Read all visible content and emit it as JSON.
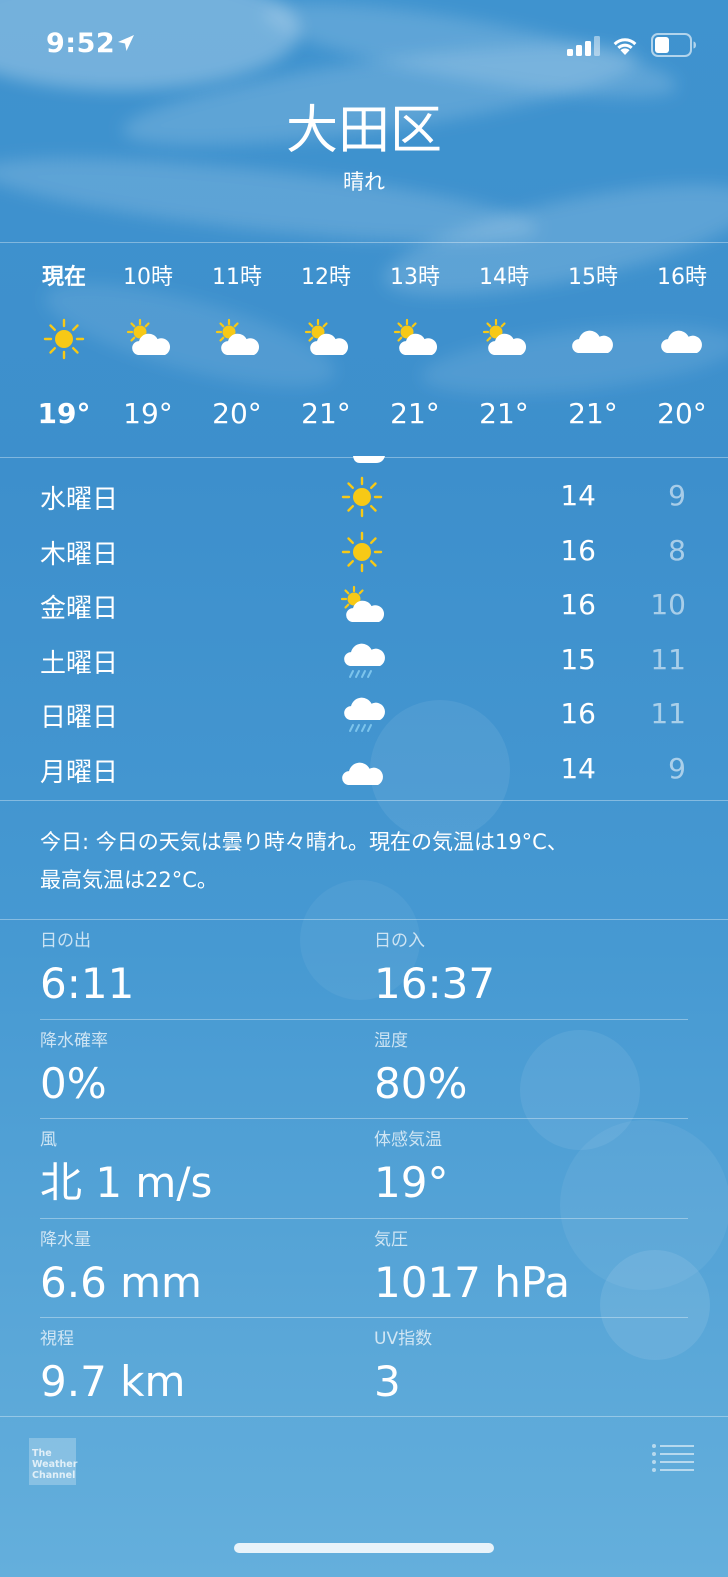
{
  "status_bar": {
    "time": "9:52"
  },
  "header": {
    "city": "大田区",
    "condition": "晴れ"
  },
  "hourly": [
    {
      "label": "現在",
      "icon": "sun-icon",
      "temp": "19°"
    },
    {
      "label": "10時",
      "icon": "partly-cloudy-icon",
      "temp": "19°"
    },
    {
      "label": "11時",
      "icon": "partly-cloudy-icon",
      "temp": "20°"
    },
    {
      "label": "12時",
      "icon": "partly-cloudy-icon",
      "temp": "21°"
    },
    {
      "label": "13時",
      "icon": "partly-cloudy-icon",
      "temp": "21°"
    },
    {
      "label": "14時",
      "icon": "partly-cloudy-icon",
      "temp": "21°"
    },
    {
      "label": "15時",
      "icon": "cloud-icon",
      "temp": "21°"
    },
    {
      "label": "16時",
      "icon": "cloud-icon",
      "temp": "20°"
    }
  ],
  "daily": [
    {
      "day": "水曜日",
      "icon": "sun-icon",
      "high": "14",
      "low": "9"
    },
    {
      "day": "木曜日",
      "icon": "sun-icon",
      "high": "16",
      "low": "8"
    },
    {
      "day": "金曜日",
      "icon": "partly-cloudy-icon",
      "high": "16",
      "low": "10"
    },
    {
      "day": "土曜日",
      "icon": "rain-icon",
      "high": "15",
      "low": "11"
    },
    {
      "day": "日曜日",
      "icon": "rain-icon",
      "high": "16",
      "low": "11"
    },
    {
      "day": "月曜日",
      "icon": "cloud-icon",
      "high": "14",
      "low": "9"
    }
  ],
  "summary": {
    "line1": "今日: 今日の天気は曇り時々晴れ。現在の気温は19°C、",
    "line2": "最高気温は22°C。"
  },
  "details": [
    {
      "left": {
        "label": "日の出",
        "value": "6:11"
      },
      "right": {
        "label": "日の入",
        "value": "16:37"
      }
    },
    {
      "left": {
        "label": "降水確率",
        "value": "0%"
      },
      "right": {
        "label": "湿度",
        "value": "80%"
      }
    },
    {
      "left": {
        "label": "風",
        "value": "北 1 m/s"
      },
      "right": {
        "label": "体感気温",
        "value": "19°"
      }
    },
    {
      "left": {
        "label": "降水量",
        "value": "6.6 mm"
      },
      "right": {
        "label": "気圧",
        "value": "1017 hPa"
      }
    },
    {
      "left": {
        "label": "視程",
        "value": "9.7 km"
      },
      "right": {
        "label": "UV指数",
        "value": "3"
      }
    }
  ],
  "footer": {
    "logo_line1": "The",
    "logo_line2": "Weather",
    "logo_line3": "Channel"
  },
  "colors": {
    "sun": "#f7c916",
    "background_top": "#3f93cf",
    "background_bottom": "#64afdc",
    "rain": "#7cc4ec"
  }
}
